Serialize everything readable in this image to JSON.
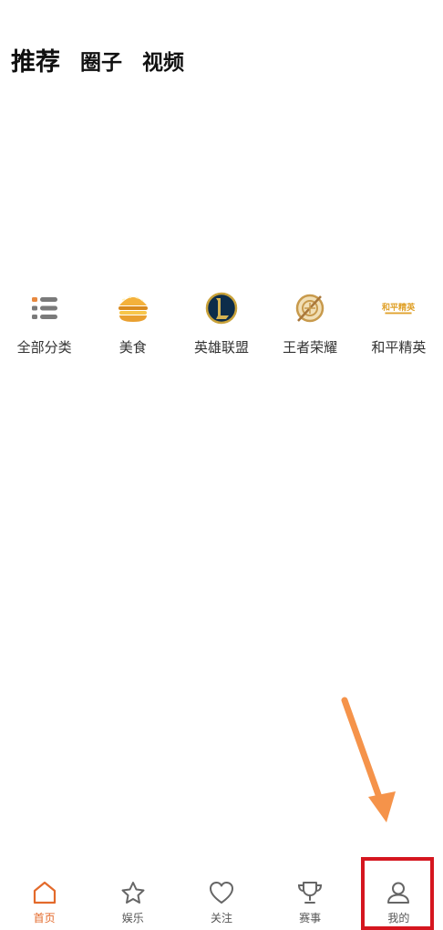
{
  "top_tabs": [
    {
      "label": "推荐"
    },
    {
      "label": "圈子"
    },
    {
      "label": "视频"
    }
  ],
  "categories": [
    {
      "label": "全部分类",
      "icon": "list-icon"
    },
    {
      "label": "美食",
      "icon": "burger-icon"
    },
    {
      "label": "英雄联盟",
      "icon": "league-of-legends-icon"
    },
    {
      "label": "王者荣耀",
      "icon": "honor-of-kings-icon"
    },
    {
      "label": "和平精英",
      "icon": "peace-elite-logo",
      "logo_text": "和平精英"
    }
  ],
  "bottom_nav": [
    {
      "label": "首页",
      "icon": "home-icon",
      "active": true
    },
    {
      "label": "娱乐",
      "icon": "star-icon"
    },
    {
      "label": "关注",
      "icon": "heart-icon"
    },
    {
      "label": "赛事",
      "icon": "trophy-icon"
    },
    {
      "label": "我的",
      "icon": "user-icon"
    }
  ],
  "colors": {
    "accent": "#e36a2b",
    "annotation_arrow": "#f5934a",
    "annotation_box": "#d5161f"
  }
}
